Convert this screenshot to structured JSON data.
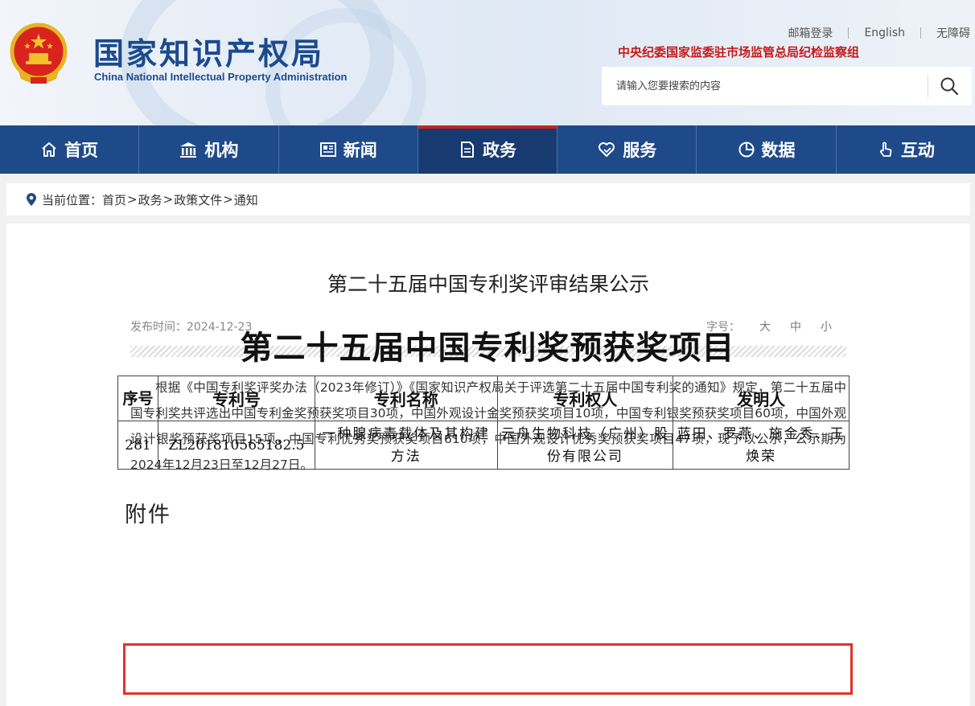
{
  "header": {
    "logo_cn": "国家知识产权局",
    "logo_en": "China National Intellectual Property Administration",
    "links": [
      "邮箱登录",
      "English",
      "无障碍"
    ],
    "org_notice": "中央纪委国家监委驻市场监管总局纪检监察组",
    "search": {
      "placeholder": "请输入您要搜索的内容"
    }
  },
  "nav": {
    "items": [
      {
        "label": "首页",
        "icon": "home-icon"
      },
      {
        "label": "机构",
        "icon": "institution-icon"
      },
      {
        "label": "新闻",
        "icon": "news-icon"
      },
      {
        "label": "政务",
        "icon": "document-icon",
        "active": true
      },
      {
        "label": "服务",
        "icon": "heart-hand-icon"
      },
      {
        "label": "数据",
        "icon": "pie-chart-icon"
      },
      {
        "label": "互动",
        "icon": "hand-pointer-icon"
      }
    ]
  },
  "breadcrumb": {
    "prefix": "当前位置：",
    "items": [
      "首页",
      "政务",
      "政策文件",
      "通知"
    ],
    "separator": ">"
  },
  "article": {
    "title": "第二十五届中国专利奖评审结果公示",
    "publish_label": "发布时间：",
    "publish_date": "2024-12-23",
    "font_label": "字号：",
    "font_sizes": [
      "大",
      "中",
      "小"
    ],
    "body": "根据《中国专利奖评奖办法（2023年修订）》《国家知识产权局关于评选第二十五届中国专利奖的通知》规定，第二十五届中国专利奖共评选出中国专利金奖预获奖项目30项，中国外观设计金奖预获奖项目10项，中国专利银奖预获奖项目60项，中国外观设计银奖预获奖项目15项，中国专利优秀奖预获奖项目610项，中国外观设计优秀奖预获奖项目47项，现予以公示，公示期为2024年12月23日至12月27日。",
    "attachment_label": "附件",
    "doc_title": "第二十五届中国专利奖预获奖项目"
  },
  "table": {
    "headers": [
      "序号",
      "专利号",
      "专利名称",
      "专利权人",
      "发明人"
    ],
    "rows": [
      [
        "281",
        "ZL201810565182.5",
        "一种腺病毒载体及其构建方法",
        "云舟生物科技（广州）股份有限公司",
        "蓝田、罗燕、施金秀、王焕荣"
      ]
    ]
  },
  "colors": {
    "nav_bg": "#1f4a8a",
    "nav_active": "#173a70",
    "active_marker": "#c8231f",
    "logo_blue": "#1b4a8e",
    "org_red": "#c31a1a",
    "highlight_red": "#e0332b"
  }
}
